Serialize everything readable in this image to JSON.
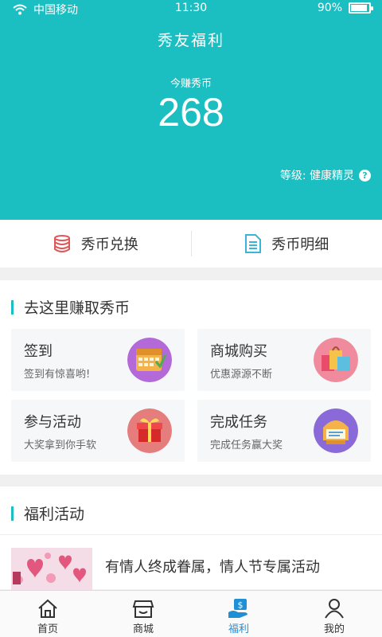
{
  "status_bar": {
    "carrier": "中国移动",
    "time": "11:30",
    "battery": "90%",
    "battery_level": 0.9
  },
  "header": {
    "title": "秀友福利",
    "earn_label": "今赚秀币",
    "earn_value": "268",
    "level_text": "等级: 健康精灵",
    "help_icon": "help-circle-icon"
  },
  "quick": {
    "exchange": "秀币兑换",
    "detail": "秀币明细"
  },
  "earn_section": {
    "title": "去这里赚取秀币",
    "cards": [
      {
        "title": "签到",
        "subtitle": "签到有惊喜哟!"
      },
      {
        "title": "商城购买",
        "subtitle": "优惠源源不断"
      },
      {
        "title": "参与活动",
        "subtitle": "大奖拿到你手软"
      },
      {
        "title": "完成任务",
        "subtitle": "完成任务赢大奖"
      }
    ]
  },
  "welfare_section": {
    "title": "福利活动",
    "items": [
      {
        "text": "有情人终成眷属，情人节专属活动"
      }
    ]
  },
  "tabs": [
    {
      "label": "首页",
      "icon": "home-icon"
    },
    {
      "label": "商城",
      "icon": "shop-icon"
    },
    {
      "label": "福利",
      "icon": "welfare-icon"
    },
    {
      "label": "我的",
      "icon": "user-icon"
    }
  ],
  "colors": {
    "primary": "#1bbfc2",
    "active_tab": "#1f8fd6",
    "exchange_icon": "#e0575a",
    "detail_icon": "#3ab4d8"
  }
}
